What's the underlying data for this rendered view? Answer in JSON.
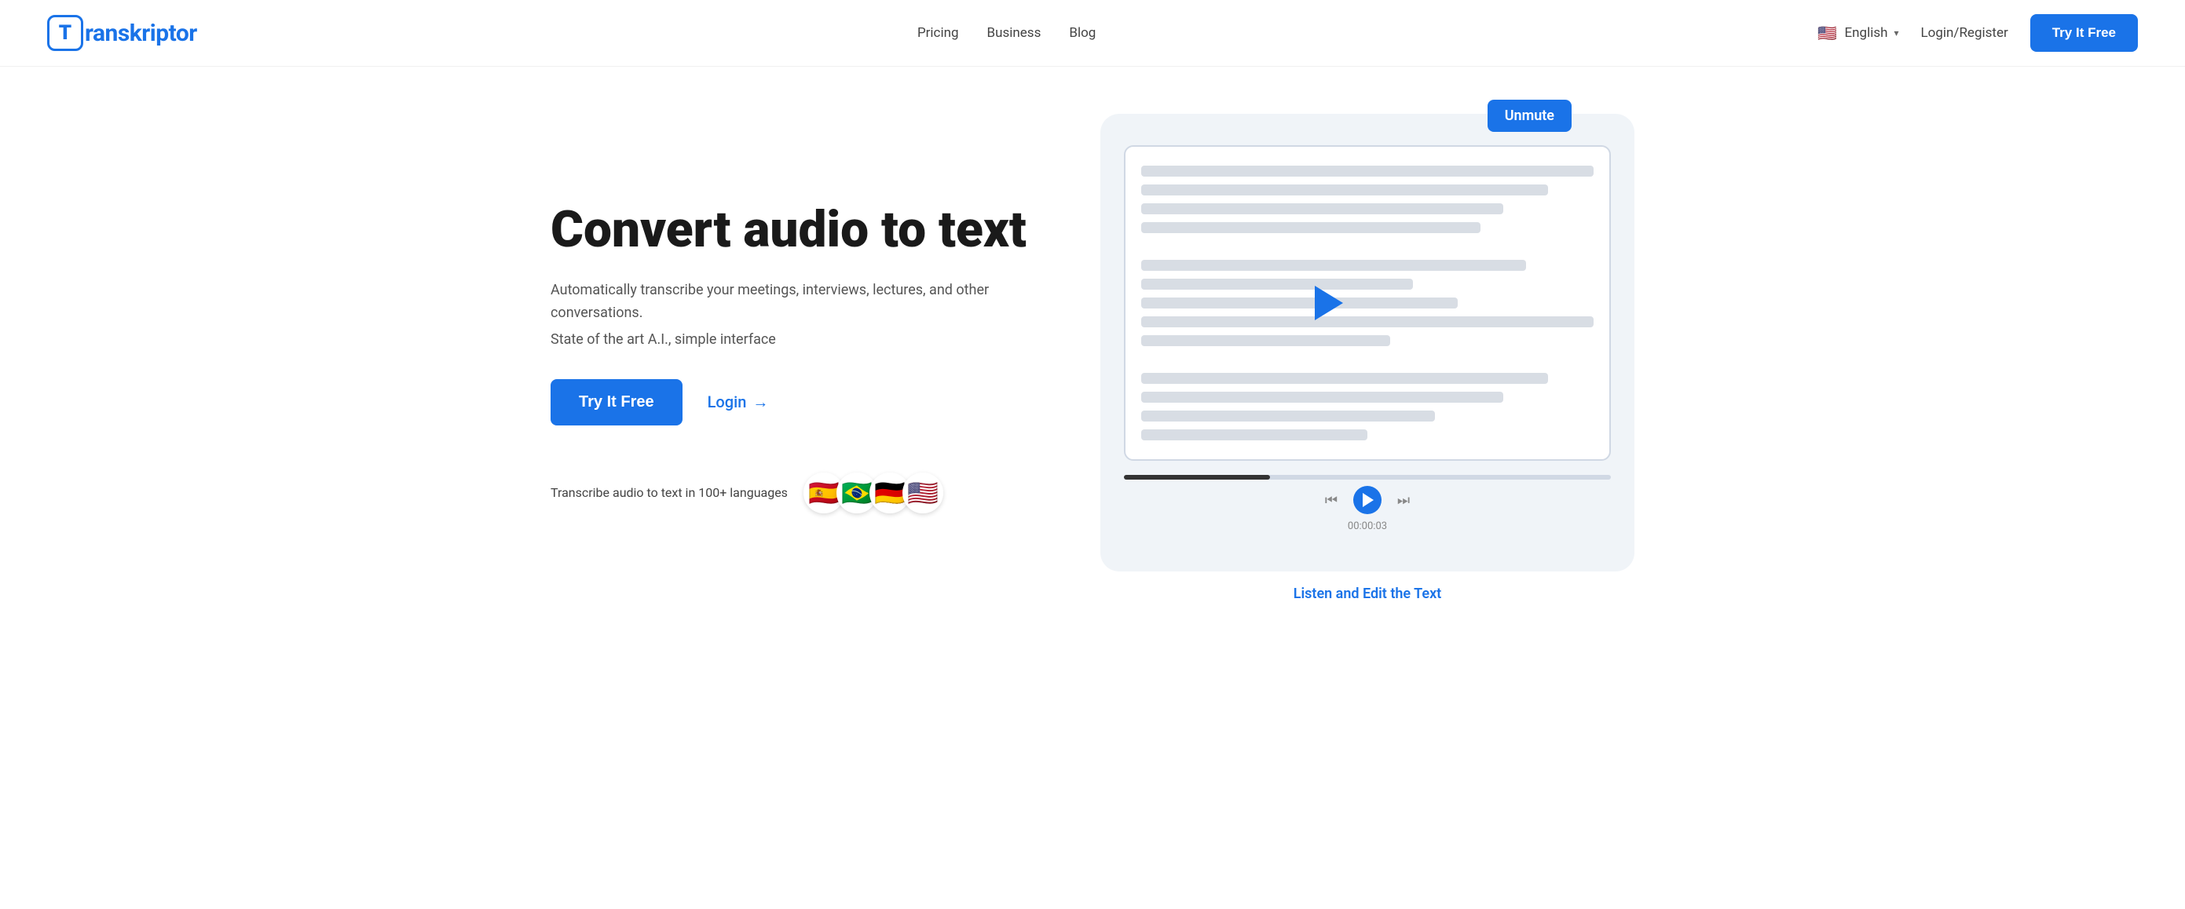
{
  "logo": {
    "icon_letter": "T",
    "brand_name": "ranskriptor"
  },
  "nav": {
    "links": [
      {
        "label": "Pricing",
        "href": "#"
      },
      {
        "label": "Business",
        "href": "#"
      },
      {
        "label": "Blog",
        "href": "#"
      }
    ],
    "language": {
      "flag": "🇺🇸",
      "label": "English"
    },
    "login_label": "Login/Register",
    "cta_label": "Try It Free"
  },
  "hero": {
    "title": "Convert audio to text",
    "subtitle1": "Automatically transcribe your meetings, interviews, lectures, and other",
    "subtitle1b": "conversations.",
    "subtitle2": "State of the art A.I., simple interface",
    "try_free_label": "Try It Free",
    "login_label": "Login",
    "login_arrow": "→",
    "languages_text": "Transcribe audio to text in 100+ languages",
    "flags": [
      "🇪🇸",
      "🇧🇷",
      "🇩🇪",
      "🇺🇸"
    ]
  },
  "illustration": {
    "unmute_label": "Unmute",
    "timestamp": "00:00:03",
    "listen_edit_label": "Listen and Edit the Text"
  }
}
